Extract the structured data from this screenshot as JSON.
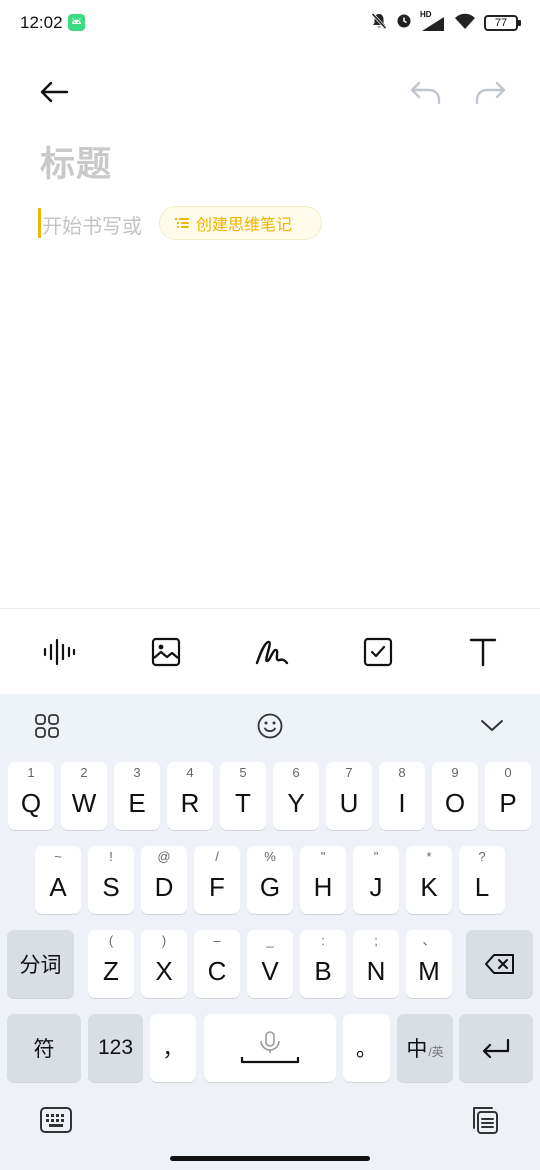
{
  "status_bar": {
    "time": "12:02",
    "icons": [
      "android-app-icon",
      "mute-icon",
      "alarm-icon",
      "hd-signal-icon",
      "wifi-icon",
      "battery-icon"
    ],
    "signal_label": "HD",
    "battery_level": "77"
  },
  "editor": {
    "title_placeholder": "标题",
    "body_placeholder": "开始书写或",
    "mind_map_chip": "创建思维笔记",
    "accent_color": "#f0b400"
  },
  "toolbar": {
    "items": [
      "voice-icon",
      "image-icon",
      "handwriting-icon",
      "checklist-icon",
      "text-format-icon"
    ]
  },
  "keyboard": {
    "row1": [
      {
        "key": "Q",
        "hint": "1"
      },
      {
        "key": "W",
        "hint": "2"
      },
      {
        "key": "E",
        "hint": "3"
      },
      {
        "key": "R",
        "hint": "4"
      },
      {
        "key": "T",
        "hint": "5"
      },
      {
        "key": "Y",
        "hint": "6"
      },
      {
        "key": "U",
        "hint": "7"
      },
      {
        "key": "I",
        "hint": "8"
      },
      {
        "key": "O",
        "hint": "9"
      },
      {
        "key": "P",
        "hint": "0"
      }
    ],
    "row2": [
      {
        "key": "A",
        "hint": "~"
      },
      {
        "key": "S",
        "hint": "!"
      },
      {
        "key": "D",
        "hint": "@"
      },
      {
        "key": "F",
        "hint": "/"
      },
      {
        "key": "G",
        "hint": "%"
      },
      {
        "key": "H",
        "hint": "\""
      },
      {
        "key": "J",
        "hint": "\""
      },
      {
        "key": "K",
        "hint": "*"
      },
      {
        "key": "L",
        "hint": "?"
      }
    ],
    "row3": [
      {
        "key": "Z",
        "hint": "("
      },
      {
        "key": "X",
        "hint": ")"
      },
      {
        "key": "C",
        "hint": "–"
      },
      {
        "key": "V",
        "hint": "_"
      },
      {
        "key": "B",
        "hint": ":"
      },
      {
        "key": "N",
        "hint": ";"
      },
      {
        "key": "M",
        "hint": "、"
      }
    ],
    "segment_key": "分词",
    "symbol_key": "符",
    "number_key": "123",
    "comma_key": "，",
    "period_key": "。",
    "lang_key_main": "中",
    "lang_key_sub": "/英"
  }
}
